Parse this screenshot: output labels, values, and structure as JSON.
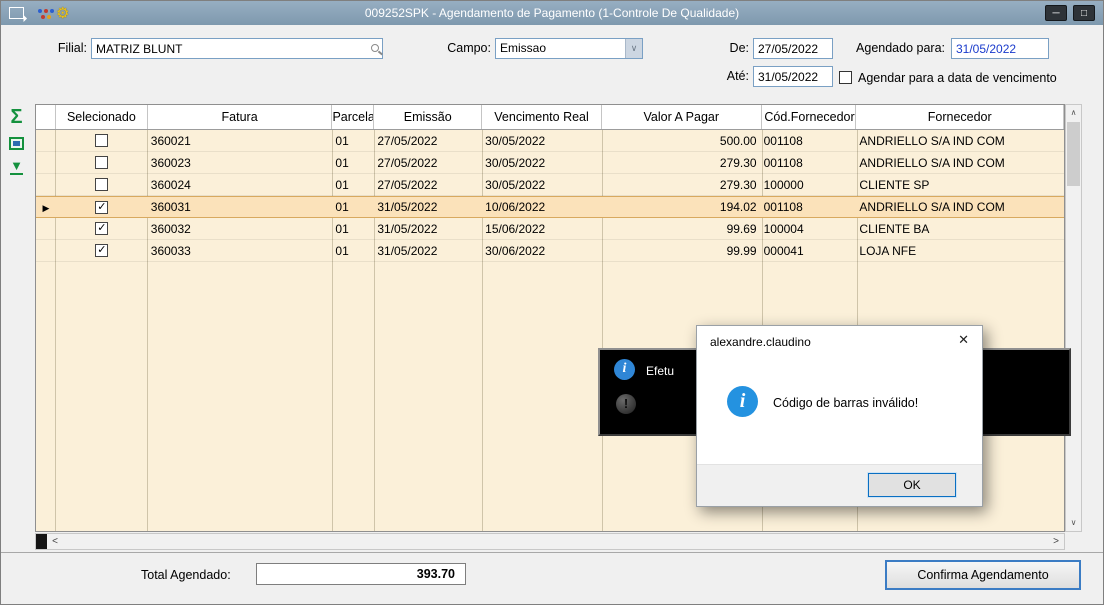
{
  "window": {
    "title": "009252SPK - Agendamento de Pagamento (1-Controle De Qualidade)"
  },
  "titlebar": {
    "minimize": "─",
    "maximize": "□"
  },
  "icons": {
    "wrench": "⚙",
    "sigma": "Σ",
    "send_bottom": "▼",
    "row_marker": "▶",
    "dropdown_arrow": "∨",
    "scroll_up": "∧",
    "scroll_down": "∨",
    "scroll_left": "<",
    "scroll_right": ">",
    "close": "✕",
    "info_i": "i",
    "alert": "!"
  },
  "form": {
    "filial_label": "Filial:",
    "filial_value": "MATRIZ BLUNT",
    "campo_label": "Campo:",
    "campo_value": "Emissao",
    "de_label": "De:",
    "de_value": "27/05/2022",
    "ate_label": "Até:",
    "ate_value": "31/05/2022",
    "agendado_label": "Agendado para:",
    "agendado_value": "31/05/2022",
    "vencimento_checkbox_label": "Agendar para a data de vencimento"
  },
  "table": {
    "headers": [
      "Selecionado",
      "Fatura",
      "Parcela",
      "Emissão",
      "Vencimento Real",
      "Valor A Pagar",
      "Cód.Fornecedor",
      "Fornecedor"
    ],
    "rows": [
      {
        "check": "",
        "fatura": "360021",
        "parcela": "01",
        "emissao": "27/05/2022",
        "vencimento": "30/05/2022",
        "valor": "500.00",
        "cod": "001108",
        "fornecedor": "ANDRIELLO S/A IND COM"
      },
      {
        "check": "",
        "fatura": "360023",
        "parcela": "01",
        "emissao": "27/05/2022",
        "vencimento": "30/05/2022",
        "valor": "279.30",
        "cod": "001108",
        "fornecedor": "ANDRIELLO S/A IND COM"
      },
      {
        "check": "",
        "fatura": "360024",
        "parcela": "01",
        "emissao": "27/05/2022",
        "vencimento": "30/05/2022",
        "valor": "279.30",
        "cod": "100000",
        "fornecedor": "CLIENTE SP"
      },
      {
        "check": "✓",
        "fatura": "360031",
        "parcela": "01",
        "emissao": "31/05/2022",
        "vencimento": "10/06/2022",
        "valor": "194.02",
        "cod": "001108",
        "fornecedor": "ANDRIELLO S/A IND COM"
      },
      {
        "check": "✓",
        "fatura": "360032",
        "parcela": "01",
        "emissao": "31/05/2022",
        "vencimento": "15/06/2022",
        "valor": "99.69",
        "cod": "100004",
        "fornecedor": "CLIENTE BA"
      },
      {
        "check": "✓",
        "fatura": "360033",
        "parcela": "01",
        "emissao": "31/05/2022",
        "vencimento": "30/06/2022",
        "valor": "99.99",
        "cod": "000041",
        "fornecedor": "LOJA NFE"
      }
    ]
  },
  "progress_popup": {
    "text": "Efetu"
  },
  "dialog": {
    "title": "alexandre.claudino",
    "message": "Código de barras inválido!",
    "ok_label": "OK"
  },
  "footer": {
    "total_label": "Total Agendado:",
    "total_value": "393.70",
    "confirm_label": "Confirma Agendamento"
  },
  "colors": {
    "titlebar": "#86a0b4",
    "grid_body": "#fbf0d9",
    "current_row": "#fbe2ba",
    "accent_blue": "#3b7cc4",
    "agendado_text": "#1a3bcc",
    "info_icon": "#2492e0"
  }
}
